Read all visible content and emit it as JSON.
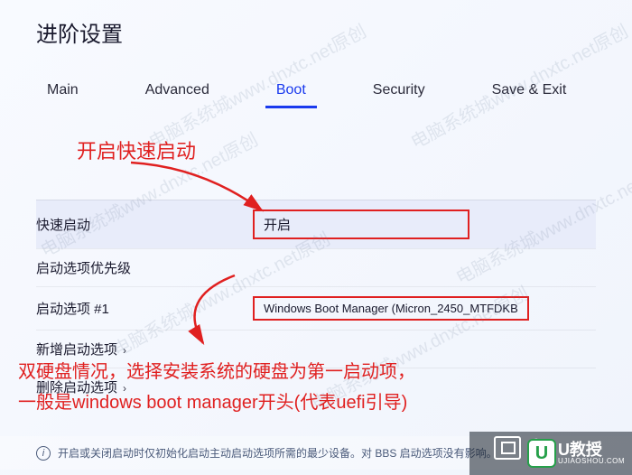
{
  "page_title": "进阶设置",
  "tabs": {
    "main": "Main",
    "advanced": "Advanced",
    "boot": "Boot",
    "security": "Security",
    "save_exit": "Save & Exit"
  },
  "annotations": {
    "fast_boot_hint": "开启快速启动",
    "boot_option_hint_line1": "双硬盘情况，选择安装系统的硬盘为第一启动项，",
    "boot_option_hint_line2": "一般是windows boot manager开头(代表uefi引导)"
  },
  "settings": {
    "fast_boot": {
      "label": "快速启动",
      "value": "开启"
    },
    "boot_priority": {
      "label": "启动选项优先级"
    },
    "boot_option_1": {
      "label": "启动选项 #1",
      "value": "Windows Boot Manager (Micron_2450_MTFDKB"
    },
    "add_boot_option": {
      "label": "新增启动选项"
    },
    "delete_boot_option": {
      "label": "删除启动选项"
    }
  },
  "help_text": "开启或关闭启动时仅初始化启动主动启动选项所需的最少设备。对 BBS 启动选项没有影响。",
  "watermark": "电脑系统城www.dnxtc.net原创",
  "logos": {
    "brand1": "电",
    "brand2_u": "U",
    "brand2_cn": "U教授",
    "brand2_en": "UJIAOSHOU.COM"
  },
  "icons": {
    "info": "i",
    "chevron_right": "›"
  }
}
